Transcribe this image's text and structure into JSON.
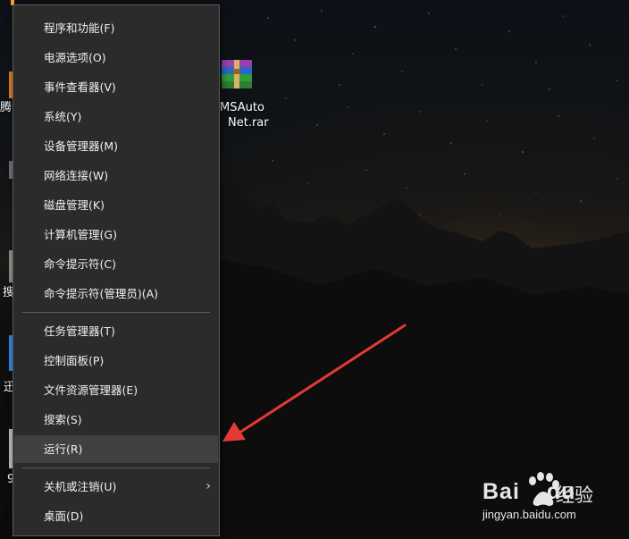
{
  "menu": {
    "items": [
      {
        "label": "程序和功能(F)"
      },
      {
        "label": "电源选项(O)"
      },
      {
        "label": "事件查看器(V)"
      },
      {
        "label": "系统(Y)"
      },
      {
        "label": "设备管理器(M)"
      },
      {
        "label": "网络连接(W)"
      },
      {
        "label": "磁盘管理(K)"
      },
      {
        "label": "计算机管理(G)"
      },
      {
        "label": "命令提示符(C)"
      },
      {
        "label": "命令提示符(管理员)(A)"
      },
      {
        "label": "任务管理器(T)"
      },
      {
        "label": "控制面板(P)"
      },
      {
        "label": "文件资源管理器(E)"
      },
      {
        "label": "搜索(S)"
      },
      {
        "label": "运行(R)",
        "highlighted": true
      },
      {
        "label": "关机或注销(U)",
        "submenu": true
      },
      {
        "label": "桌面(D)"
      }
    ],
    "submenu_glyph": "›"
  },
  "desktop": {
    "rar_label_line1": "MSAuto",
    "rar_label_line2": "Net.rar",
    "icon_name": "winrar-archive-icon",
    "partial_labels": [
      "腾",
      "搜",
      "迅",
      "9"
    ]
  },
  "watermark": {
    "brand": "Bai",
    "brand2": "du",
    "cn": "经验",
    "url": "jingyan.baidu.com"
  },
  "colors": {
    "menu_bg": "#2b2b2b",
    "menu_highlight": "#414141",
    "arrow": "#e53935"
  }
}
